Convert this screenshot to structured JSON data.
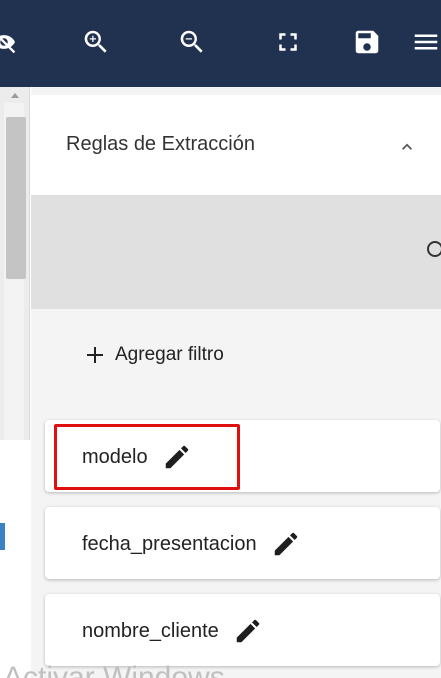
{
  "toolbar": {
    "icons": [
      "eye-off-icon",
      "zoom-in-icon",
      "zoom-out-icon",
      "fullscreen-icon",
      "save-icon",
      "menu-icon"
    ]
  },
  "panel": {
    "title": "Reglas de Extracción",
    "add_filter_label": "Agregar filtro"
  },
  "rules": [
    {
      "label": "modelo",
      "highlighted": true
    },
    {
      "label": "fecha_presentacion",
      "highlighted": false
    },
    {
      "label": "nombre_cliente",
      "highlighted": false
    }
  ],
  "watermark": "Activar Windows",
  "colors": {
    "toolbar_bg": "#213251",
    "highlight": "#e01010",
    "grey_band": "#e0e0e0"
  }
}
